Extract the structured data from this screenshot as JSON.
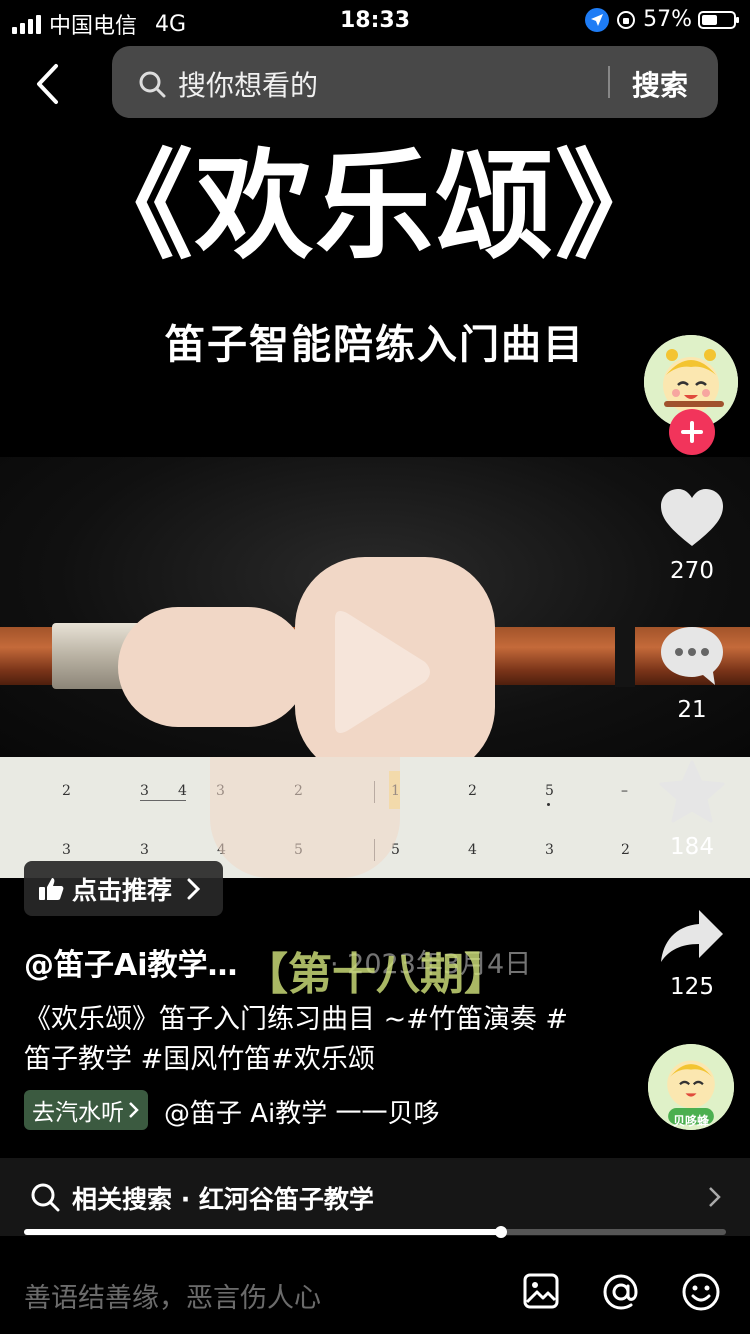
{
  "status": {
    "carrier": "中国电信",
    "network": "4G",
    "time": "18:33",
    "battery": "57%",
    "battery_level": 0.57
  },
  "search": {
    "placeholder": "搜你想看的",
    "button": "搜索"
  },
  "video": {
    "title": "《欢乐颂》",
    "subtitle": "笛子智能陪练入门曲目",
    "overlay_caption": "【第十八期】",
    "score": {
      "row1": [
        "2",
        "3",
        "4",
        "3",
        "2",
        "1",
        "2",
        "5",
        "–"
      ],
      "row2": [
        "3",
        "3",
        "4",
        "5",
        "5",
        "4",
        "3",
        "2"
      ]
    }
  },
  "actions": {
    "likes": "270",
    "comments": "21",
    "favorites": "184",
    "shares": "125"
  },
  "recommend": {
    "label": "点击推荐"
  },
  "post": {
    "author": "@笛子Ai教学…",
    "date": "· 2023年3月4日",
    "description": "《欢乐颂》笛子入门练习曲目 ~#竹笛演奏 #笛子教学 #国风竹笛#欢乐颂",
    "music_chip": "去汽水听",
    "music_text": "@笛子 Ai教学 一一贝哆"
  },
  "related": {
    "text": "相关搜索 · 红河谷笛子教学"
  },
  "progress": {
    "fraction": 0.68
  },
  "comment": {
    "placeholder": "善语结善缘，恶言伤人心"
  },
  "music_avatar_label": "贝哆蜂",
  "colors": {
    "follow": "#f2345b",
    "music_chip": "#3b5a40",
    "accent_yellow": "#f3c431"
  }
}
